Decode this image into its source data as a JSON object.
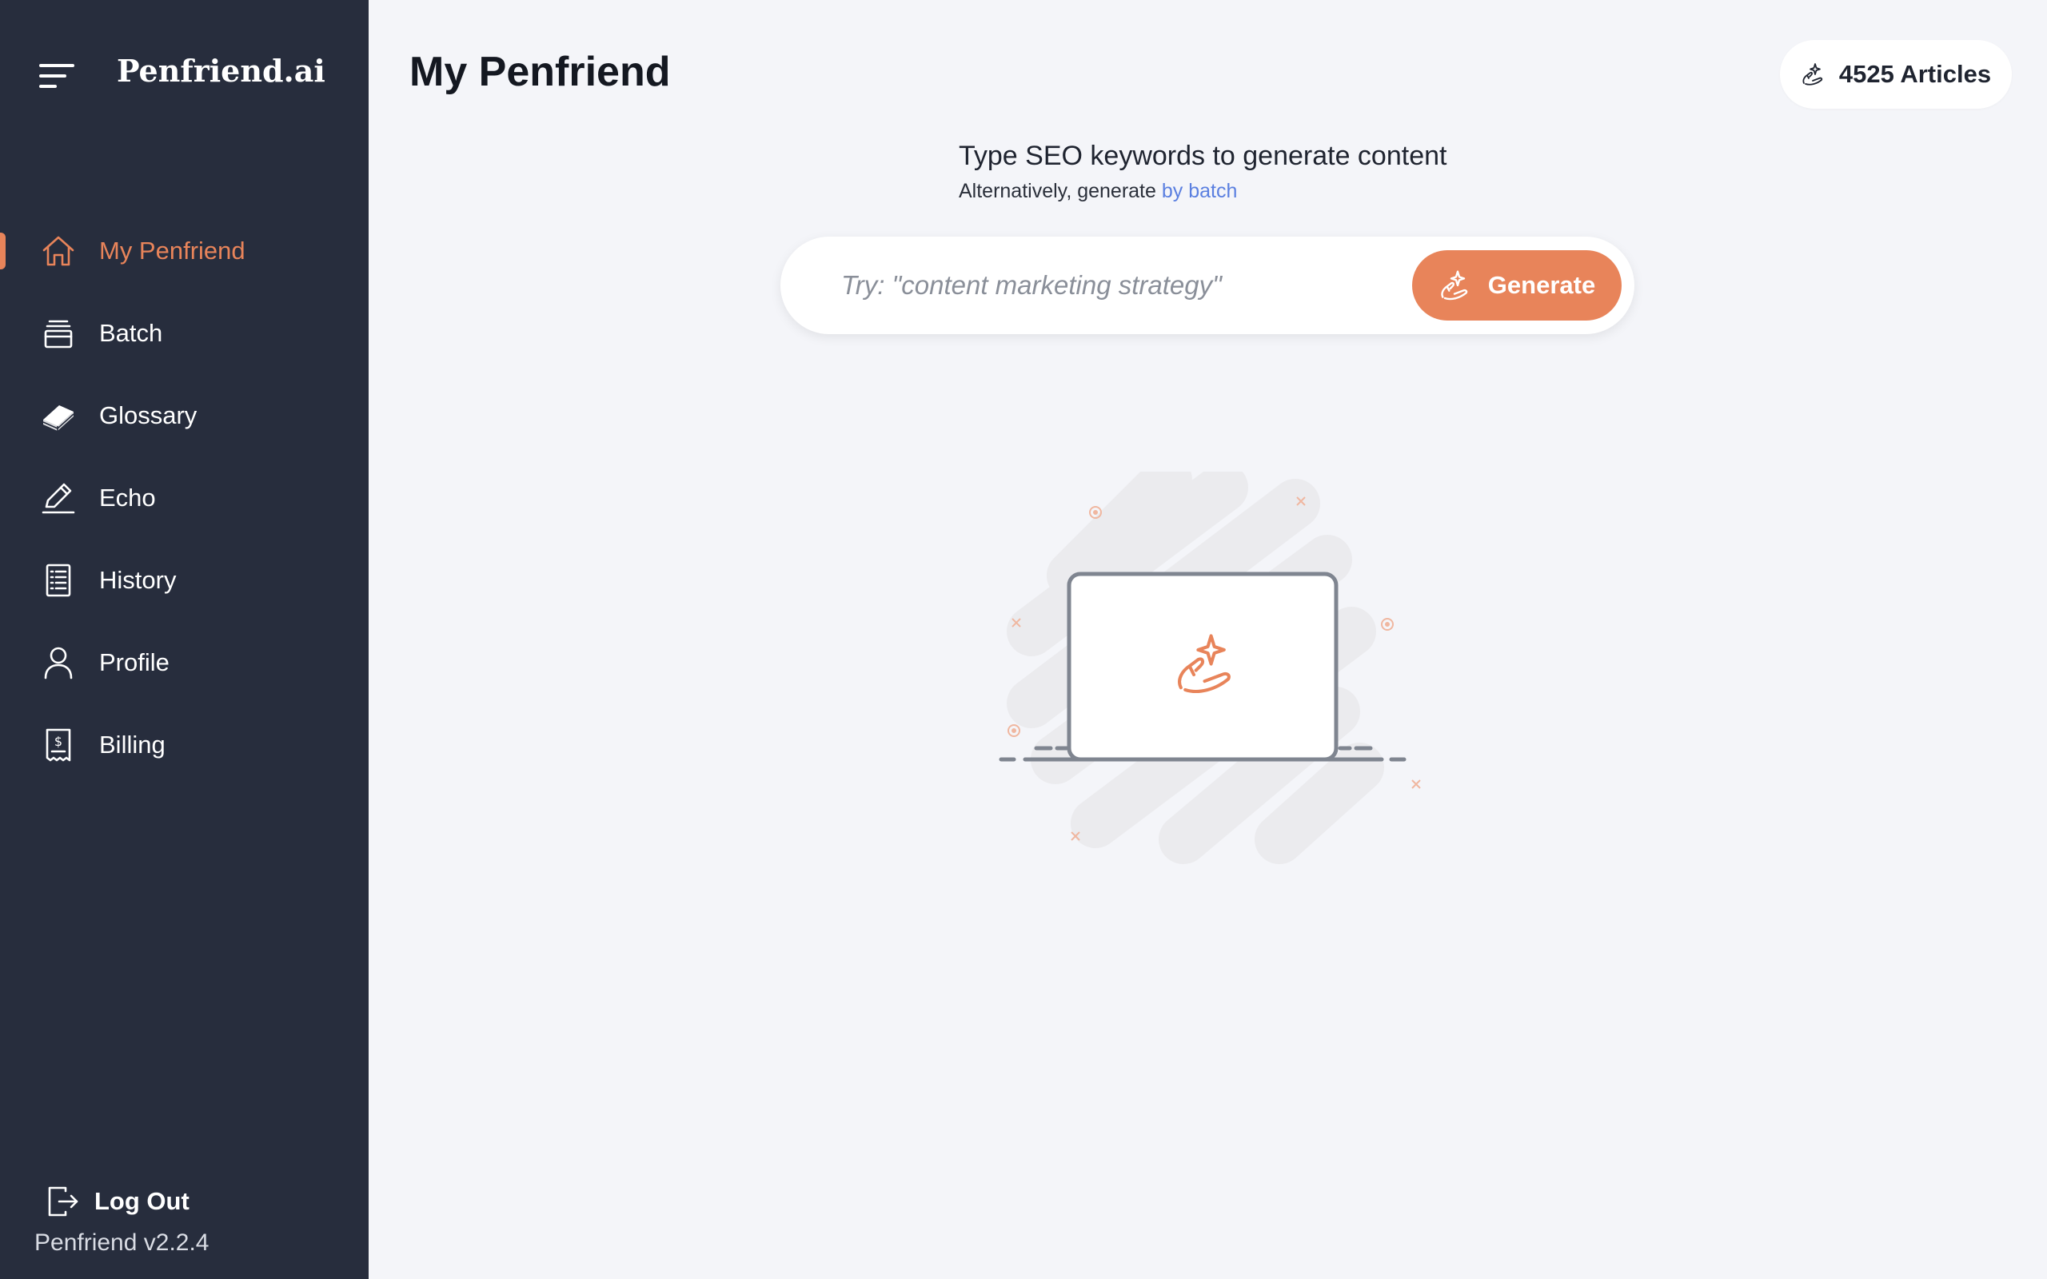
{
  "sidebar": {
    "brand": "Penfriend.ai",
    "items": [
      {
        "label": "My Penfriend",
        "icon": "home-icon",
        "active": true
      },
      {
        "label": "Batch",
        "icon": "batch-icon",
        "active": false
      },
      {
        "label": "Glossary",
        "icon": "glossary-icon",
        "active": false
      },
      {
        "label": "Echo",
        "icon": "pencil-icon",
        "active": false
      },
      {
        "label": "History",
        "icon": "history-icon",
        "active": false
      },
      {
        "label": "Profile",
        "icon": "profile-icon",
        "active": false
      },
      {
        "label": "Billing",
        "icon": "billing-icon",
        "active": false
      }
    ],
    "logout_label": "Log Out",
    "version": "Penfriend v2.2.4"
  },
  "header": {
    "title": "My Penfriend",
    "articles": "4525 Articles"
  },
  "prompt": {
    "title": "Type SEO keywords to generate content",
    "subtitle_prefix": "Alternatively, generate",
    "subtitle_link": "by batch"
  },
  "search": {
    "placeholder": "Try: \"content marketing strategy\"",
    "value": "",
    "button_label": "Generate"
  },
  "colors": {
    "accent": "#e8845a",
    "sidebar_bg": "#272d3d",
    "page_bg": "#f4f5f9",
    "link": "#5a7fe0"
  }
}
